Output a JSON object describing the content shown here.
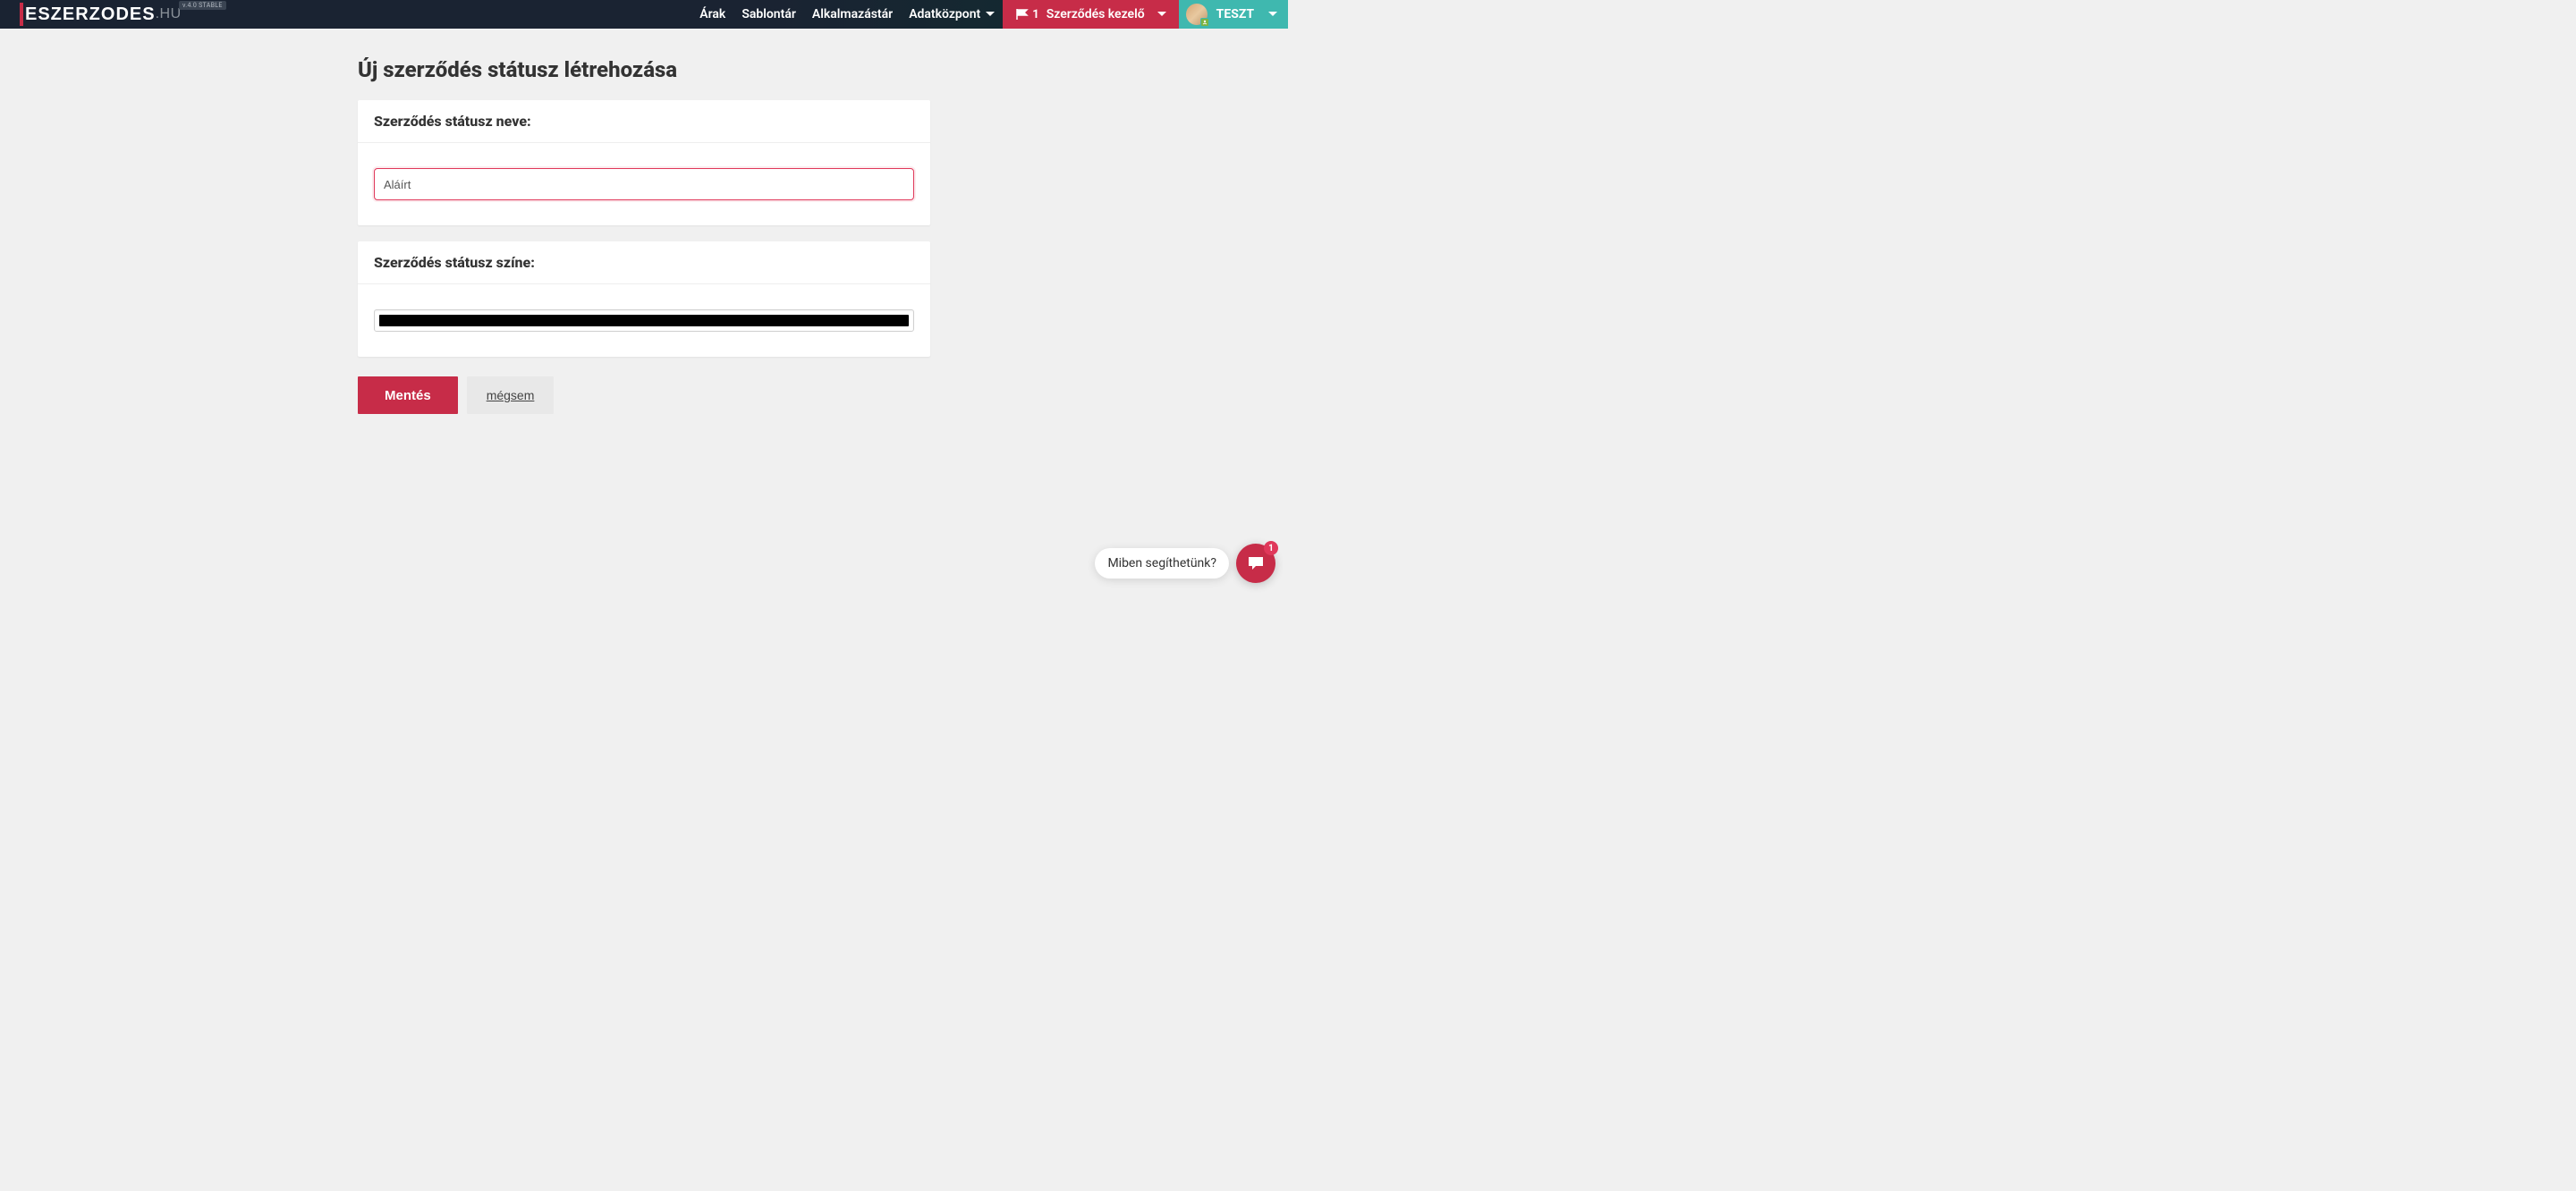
{
  "brand": {
    "name": "ESZERZODES",
    "suffix": ".HU",
    "version": "v.4.0 STABLE"
  },
  "nav": {
    "pricing": "Árak",
    "templates": "Sablontár",
    "apps": "Alkalmazástár",
    "datacenter": "Adatközpont",
    "contract_count": "1",
    "contract_manager": "Szerződés kezelő",
    "user_name": "TESZT"
  },
  "page": {
    "title": "Új szerződés státusz létrehozása"
  },
  "form": {
    "name_label": "Szerződés státusz neve:",
    "name_value": "Aláírt",
    "color_label": "Szerződés státusz színe:",
    "color_value": "#000000",
    "save_label": "Mentés",
    "cancel_label": "mégsem"
  },
  "chat": {
    "prompt": "Miben segíthetünk?",
    "badge_count": "1"
  }
}
